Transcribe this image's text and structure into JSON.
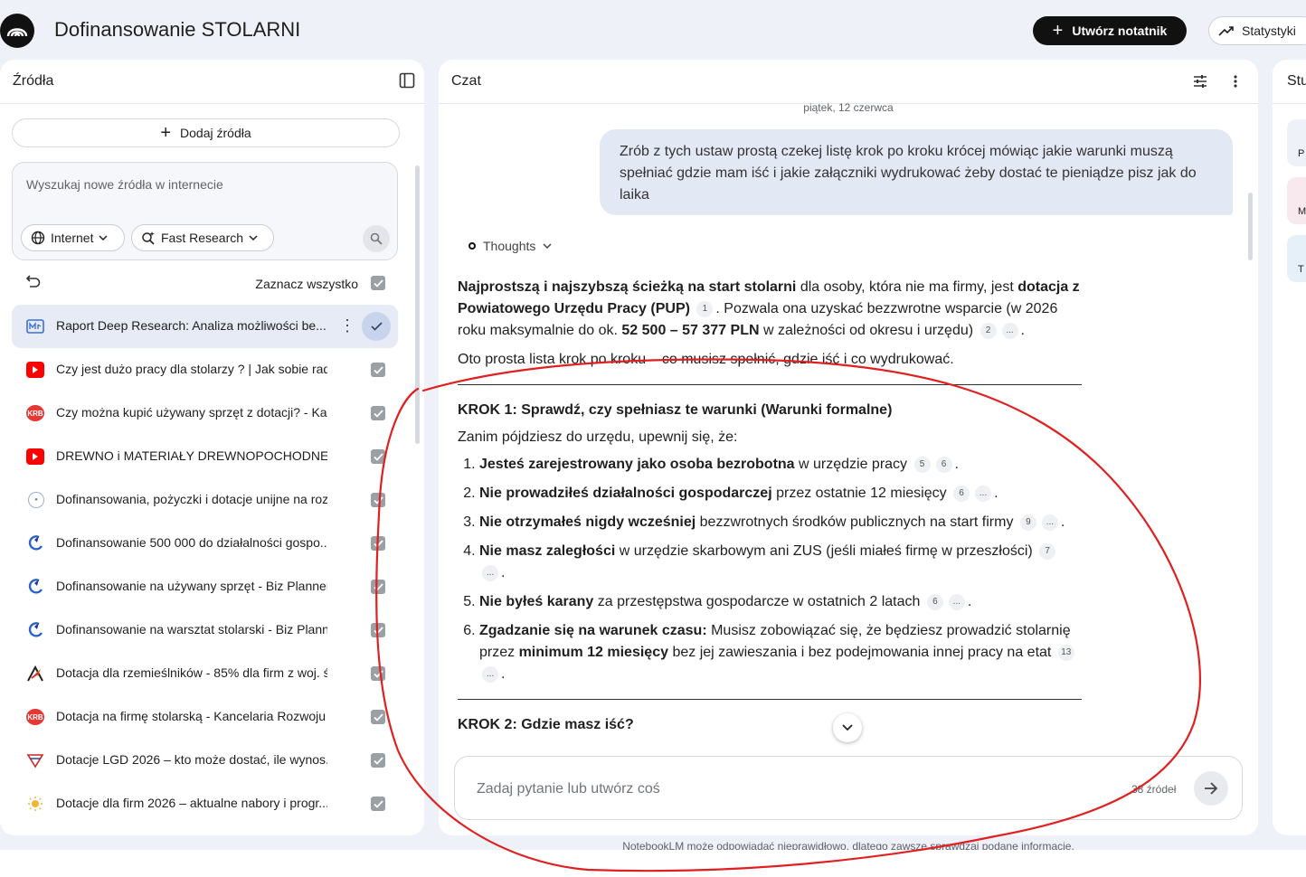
{
  "header": {
    "notebook_title": "Dofinansowanie STOLARNI",
    "create_notebook_label": "Utwórz notatnik",
    "stats_label": "Statystyki"
  },
  "sources_panel": {
    "title": "Źródła",
    "add_sources_label": "Dodaj źródła",
    "search_placeholder": "Wyszukaj nowe źródła w internecie",
    "chip_internet": "Internet",
    "chip_fast_research": "Fast Research",
    "select_all_label": "Zaznacz wszystko",
    "items": [
      {
        "title": "Raport Deep Research: Analiza możliwości be...",
        "icon": "report-icon"
      },
      {
        "title": "Czy jest dużo pracy dla stolarzy ? | Jak sobie rad...",
        "icon": "youtube-icon"
      },
      {
        "title": "Czy można kupić używany sprzęt z dotacji? - Ka...",
        "icon": "krb-logo-icon"
      },
      {
        "title": "DREWNO i MATERIAŁY DREWNOPOCHODNE -W...",
        "icon": "youtube-icon"
      },
      {
        "title": "Dofinansowania, pożyczki i dotacje unijne na roz...",
        "icon": "globe-icon"
      },
      {
        "title": "Dofinansowanie 500 000 do działalności gospo...",
        "icon": "bizplanner-icon"
      },
      {
        "title": "Dofinansowanie na używany sprzęt - Biz Planner...",
        "icon": "bizplanner-icon"
      },
      {
        "title": "Dofinansowanie na warsztat stolarski - Biz Plann...",
        "icon": "bizplanner-icon"
      },
      {
        "title": "Dotacja dla rzemieślników - 85% dla firm z woj. ś...",
        "icon": "star-logo-icon"
      },
      {
        "title": "Dotacja na firmę stolarską - Kancelaria Rozwoju ...",
        "icon": "krb-logo-icon"
      },
      {
        "title": "Dotacje LGD 2026 – kto może dostać, ile wynos...",
        "icon": "lgd-logo-icon"
      },
      {
        "title": "Dotacje dla firm 2026 – aktualne nabory i progr...",
        "icon": "sun-logo-icon"
      }
    ]
  },
  "chat": {
    "title": "Czat",
    "date": "piątek, 12 czerwca",
    "user_message": "Zrób z tych ustaw prostą czekej listę krok po kroku krócej mówiąc jakie warunki muszą spełniać gdzie mam iść i jakie załączniki wydrukować żeby dostać te pieniądze pisz jak do laika",
    "thoughts_label": "Thoughts",
    "intro": {
      "b1": "Najprostszą i najszybszą ścieżką na start stolarni",
      "t1": " dla osoby, która nie ma firmy, jest ",
      "b2": "dotacja z Powiatowego Urzędu Pracy (PUP)",
      "c1": "1",
      "t2": ". Pozwala ona uzyskać bezzwrotne wsparcie (w 2026 roku maksymalnie do ok. ",
      "b3": "52 500 – 57 377 PLN",
      "t3": " w zależności od okresu i urzędu)",
      "c2": "2",
      "more": "...",
      "end": "."
    },
    "lead": "Oto prosta lista krok po kroku – co musisz spełnić, gdzie iść i co wydrukować.",
    "step1_heading": "KROK 1: Sprawdź, czy spełniasz te warunki (Warunki formalne)",
    "step1_lead": "Zanim pójdziesz do urzędu, upewnij się, że:",
    "conditions": [
      {
        "bold": "Jesteś zarejestrowany jako osoba bezrobotna",
        "text": " w urzędzie pracy",
        "c1": "5",
        "c2": "6",
        "end": "."
      },
      {
        "bold": "Nie prowadziłeś działalności gospodarczej",
        "text": " przez ostatnie 12 miesięcy",
        "c1": "6",
        "c2": "...",
        "end": "."
      },
      {
        "bold": "Nie otrzymałeś nigdy wcześniej",
        "text": " bezzwrotnych środków publicznych na start firmy",
        "c1": "9",
        "c2": "...",
        "end": "."
      },
      {
        "bold": "Nie masz zaległości",
        "text": " w urzędzie skarbowym ani ZUS (jeśli miałeś firmę w przeszłości)",
        "c1": "7",
        "c2": "...",
        "end": "."
      },
      {
        "bold": "Nie byłeś karany",
        "text": " za przestępstwa gospodarcze w ostatnich 2 latach",
        "c1": "6",
        "c2": "...",
        "end": "."
      },
      {
        "bold": "Zgadzanie się na warunek czasu:",
        "text": " Musisz zobowiązać się, że będziesz prowadzić stolarnię przez ",
        "bold2": "minimum 12 miesięcy",
        "text2": " bez jej zawieszania i bez podejmowania innej pracy na etat",
        "c1": "13",
        "c2": "...",
        "end": "."
      }
    ],
    "step2_heading": "KROK 2: Gdzie masz iść?",
    "composer_placeholder": "Zadaj pytanie lub utwórz coś",
    "sources_count": "38 źródeł"
  },
  "studio_panel": {
    "title_partial": "Stu",
    "card_letters": [
      "P",
      "M",
      "T"
    ]
  },
  "disclaimer": "NotebookLM może odpowiadać nieprawidłowo, dlatego zawsze sprawdzaj podane informacje.",
  "colors": {
    "background": "#eef1f8",
    "accent_dark": "#111111",
    "user_bubble": "#e3e8f5",
    "active_source": "#e6ebf6",
    "annotation_red": "#e02020"
  }
}
